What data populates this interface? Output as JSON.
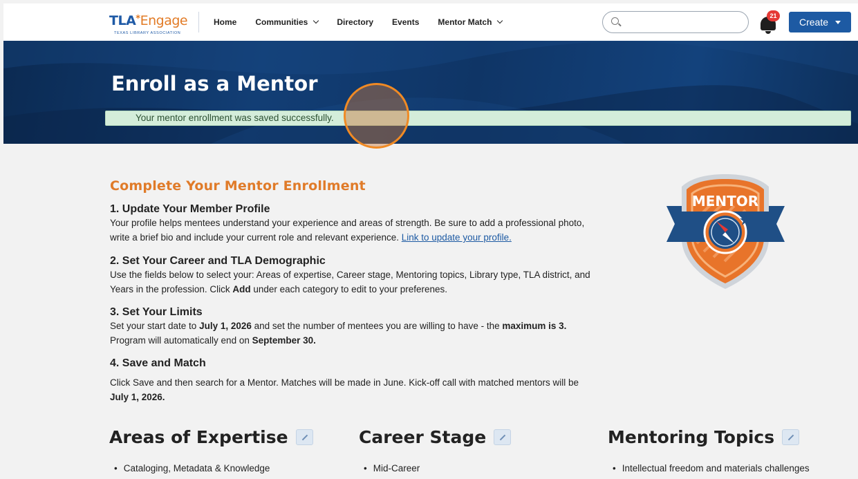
{
  "header": {
    "logo": {
      "tla": "TLA",
      "star": "*",
      "engage": "Engage",
      "sub": "TEXAS LIBRARY ASSOCIATION"
    },
    "nav": [
      {
        "label": "Home",
        "dropdown": false
      },
      {
        "label": "Communities",
        "dropdown": true
      },
      {
        "label": "Directory",
        "dropdown": false
      },
      {
        "label": "Events",
        "dropdown": false
      },
      {
        "label": "Mentor Match",
        "dropdown": true
      }
    ],
    "search": {
      "value": "",
      "placeholder": ""
    },
    "notifications": {
      "count": "21"
    },
    "create_label": "Create"
  },
  "banner": {
    "title": "Enroll as a Mentor",
    "alert": "Your mentor enrollment was saved successfully."
  },
  "content": {
    "heading": "Complete Your Mentor Enrollment",
    "steps": [
      {
        "title": "1. Update Your Member Profile",
        "text_1": "Your profile helps mentees understand your experience and areas of strength. Be sure to add a professional photo, write a brief bio and include your current role and relevant experience. ",
        "link": "Link to update your profile."
      },
      {
        "title": "2. Set Your Career and TLA Demographic",
        "text_1": "Use the fields below to select your: Areas of expertise, Career stage, Mentoring topics, Library type, TLA district, and Years in the profession. Click ",
        "bold_1": "Add",
        "text_2": " under each category to edit to your preferenes."
      },
      {
        "title": "3. Set Your Limits",
        "text_1": "Set your start date to ",
        "bold_1": "July 1, 2026",
        "text_2": " and set the number of mentees you are willing to have - the ",
        "bold_2": "maximum is 3.",
        "text_3": " Program will automatically end on ",
        "bold_3": "September 30."
      },
      {
        "title": "4. Save and Match",
        "text_1": "Click Save and then search for a Mentor. Matches will be made in June. Kick-off call with matched mentors will be ",
        "bold_1": "July 1, 2026."
      }
    ]
  },
  "badge": {
    "text": "MENTOR"
  },
  "columns": [
    {
      "title": "Areas of Expertise",
      "items": [
        "Cataloging, Metadata & Knowledge"
      ]
    },
    {
      "title": "Career Stage",
      "items": [
        "Mid-Career"
      ]
    },
    {
      "title": "Mentoring Topics",
      "items": [
        "Intellectual freedom and materials challenges"
      ]
    }
  ],
  "colors": {
    "brand_blue": "#1d5aa3",
    "accent_orange": "#e07b29",
    "alert_green": "#d4edda",
    "badge_red": "#e53935"
  }
}
